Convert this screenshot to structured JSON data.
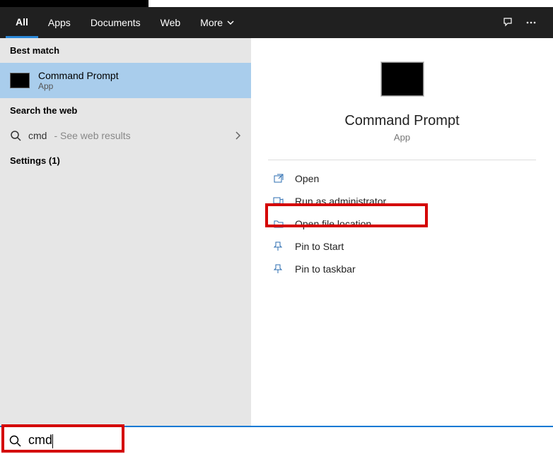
{
  "tabs": {
    "all": "All",
    "apps": "Apps",
    "documents": "Documents",
    "web": "Web",
    "more": "More"
  },
  "left": {
    "best_match_label": "Best match",
    "best_match": {
      "title": "Command Prompt",
      "sub": "App"
    },
    "search_web_label": "Search the web",
    "web_row": {
      "term": "cmd",
      "suffix": " - See web results"
    },
    "settings_label": "Settings (1)"
  },
  "right": {
    "title": "Command Prompt",
    "sub": "App",
    "actions": {
      "open": "Open",
      "run_admin": "Run as administrator",
      "open_location": "Open file location",
      "pin_start": "Pin to Start",
      "pin_taskbar": "Pin to taskbar"
    }
  },
  "search": {
    "value": "cmd"
  }
}
